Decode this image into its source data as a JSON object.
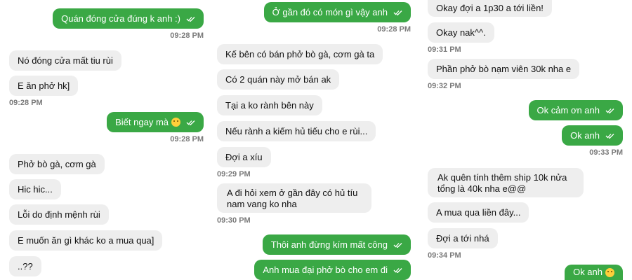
{
  "col1": {
    "messages": [
      {
        "text": "Quán đóng cửa đúng k anh :)"
      },
      {
        "text": "Nó đóng cửa mất tiu rùi"
      },
      {
        "text": "E ăn phở hk]"
      },
      {
        "text": "Biết ngay mà"
      },
      {
        "text": "Phở bò gà, cơm gà"
      },
      {
        "text": "Hic hic..."
      },
      {
        "text": "Lỗi do định mệnh rùi"
      },
      {
        "text": "E muốn ăn gì khác ko a mua qua]"
      },
      {
        "text": "..??"
      }
    ],
    "timestamps": [
      "09:28 PM",
      "09:28 PM",
      "09:28 PM"
    ]
  },
  "col2": {
    "messages": [
      {
        "text": "Ở gần đó có món gì vậy anh"
      },
      {
        "text": "Kế bên có bán phở bò gà, cơm gà ta"
      },
      {
        "text": "Có 2 quán này mở bán ak"
      },
      {
        "text": "Tại a ko rành bên này"
      },
      {
        "text": "Nếu rành a kiếm hủ tiếu cho e rùi..."
      },
      {
        "text": "Đợi a xíu"
      },
      {
        "text": "A đi hỏi xem ở gần đây có hủ tíu nam vang ko nha"
      },
      {
        "text": "Thôi anh đừng kím mất công"
      },
      {
        "text": "Anh mua đại phở bò cho em đi"
      }
    ],
    "timestamps": [
      "09:28 PM",
      "09:29 PM",
      "09:30 PM"
    ]
  },
  "col3": {
    "messages": [
      {
        "text": "Okay đợi a 1p30 a tới liền!"
      },
      {
        "text": "Okay nak^^."
      },
      {
        "text": "Phần phở bò nạm viên 30k nha e"
      },
      {
        "text": "Ok cảm ơn anh"
      },
      {
        "text": "Ok anh"
      },
      {
        "text": "Ak quên tính thêm ship 10k nửa tổng là 40k nha e@@"
      },
      {
        "text": "A mua qua liền đây..."
      },
      {
        "text": "Đợi a tới nhá"
      },
      {
        "text": "Ok anh"
      }
    ],
    "timestamps": [
      "09:31 PM",
      "09:32 PM",
      "09:33 PM",
      "09:34 PM"
    ]
  },
  "colors": {
    "sent": "#3aa845",
    "received": "#eeeeee",
    "timestamp": "#7a7a7a"
  },
  "icons": {
    "read_receipt": "double-check-icon",
    "emoji": "smiley-emoji-icon"
  }
}
